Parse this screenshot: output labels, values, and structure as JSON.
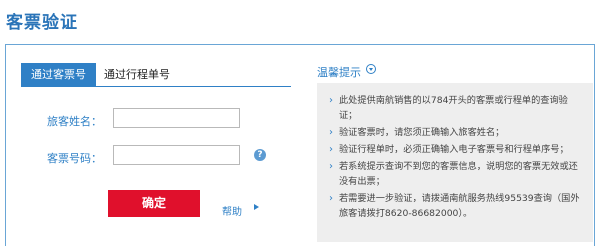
{
  "page": {
    "title": "客票验证"
  },
  "tabs": [
    {
      "label": "通过客票号",
      "active": true
    },
    {
      "label": "通过行程单号",
      "active": false
    }
  ],
  "form": {
    "name_label": "旅客姓名：",
    "ticket_label": "客票号码：",
    "name_value": "",
    "ticket_value": "",
    "confirm_label": "确定",
    "help_label": "帮助",
    "help_icon": "question-icon",
    "help_badge": "?"
  },
  "tips": {
    "title": "温馨提示",
    "items": [
      "此处提供南航销售的以784开头的客票或行程单的查询验证；",
      "验证客票时，请您须正确输入旅客姓名；",
      "验证行程单时，必须正确输入电子客票号和行程单序号；",
      "若系统提示查询不到您的客票信息，说明您的客票无效或还没有出票；",
      "若需要进一步验证，请拨通南航服务热线95539查询（国外旅客请拨打8620-86682000）。"
    ]
  },
  "colors": {
    "accent": "#2f80c6",
    "title": "#2a74b8",
    "button": "#e0102c",
    "tips_bg": "#eeeeee"
  }
}
